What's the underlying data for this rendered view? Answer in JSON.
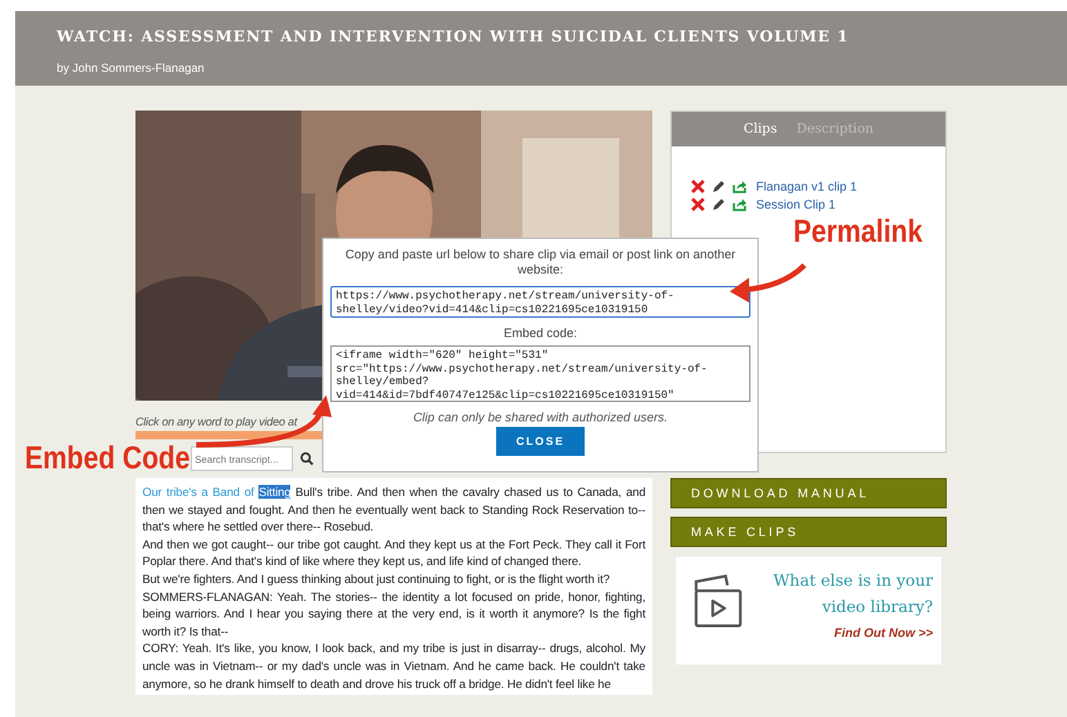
{
  "header": {
    "title": "WATCH: ASSESSMENT AND INTERVENTION WITH SUICIDAL CLIENTS VOLUME 1",
    "byline": "by John Sommers-Flanagan"
  },
  "transcript": {
    "hint": "Click on any word to play video at",
    "search": {
      "placeholder": "Search transcript..."
    },
    "paragraphs": [
      [
        {
          "kind": "played",
          "text": "Our tribe's a Band of "
        },
        {
          "kind": "current",
          "text": "Sitting"
        },
        {
          "kind": "plain",
          "text": " Bull's tribe. And then when the cavalry chased us to Canada, and then we stayed and fought. And then he eventually went back to Standing Rock Reservation to-- that's where he settled over there-- Rosebud."
        }
      ],
      [
        {
          "kind": "plain",
          "text": "And then we got caught-- our tribe got caught. And they kept us at the Fort Peck. They call it Fort Poplar there. And that's kind of like where they kept us, and life kind of changed there."
        }
      ],
      [
        {
          "kind": "plain",
          "text": "But we're fighters. And I guess thinking about just continuing to fight, or is the flight worth it?"
        }
      ],
      [
        {
          "kind": "plain",
          "text": "SOMMERS-FLANAGAN: Yeah. The stories-- the identity a lot focused on pride, honor, fighting, being warriors. And I hear you saying there at the very end, is it worth it anymore? Is the fight worth it? Is that--"
        }
      ],
      [
        {
          "kind": "plain",
          "text": "CORY: Yeah. It's like, you know, I look back, and my tribe is just in disarray-- drugs, alcohol. My uncle was in Vietnam-- or my dad's uncle was in Vietnam. And he came back. He couldn't take anymore, so he drank himself to death and drove his truck off a bridge. He didn't feel like he"
        }
      ]
    ]
  },
  "sidebar": {
    "tabs": [
      {
        "label": "Clips",
        "selected": true
      },
      {
        "label": "Description",
        "selected": false
      }
    ],
    "clips": [
      {
        "title": "Flanagan v1 clip 1"
      },
      {
        "title": "Session Clip 1"
      }
    ],
    "buttons": [
      "DOWNLOAD MANUAL",
      "MAKE CLIPS"
    ],
    "promo": {
      "heading": "What else is in your video library?",
      "link": "Find Out Now >>"
    }
  },
  "share_dialog": {
    "instruction": "Copy and paste url below to share clip via email or post link on another website:",
    "url": "https://www.psychotherapy.net/stream/university-of-shelley/video?vid=414&clip=cs10221695ce10319150",
    "embed_label": "Embed code:",
    "embed_code": "<iframe width=\"620\" height=\"531\" src=\"https://www.psychotherapy.net/stream/university-of-shelley/embed?vid=414&id=7bdf40747e125&clip=cs10221695ce10319150\"",
    "note": "Clip can only be shared with authorized users.",
    "close": "CLOSE"
  },
  "annotations": [
    {
      "text": "Permalink"
    },
    {
      "text": "Embed Code"
    }
  ]
}
